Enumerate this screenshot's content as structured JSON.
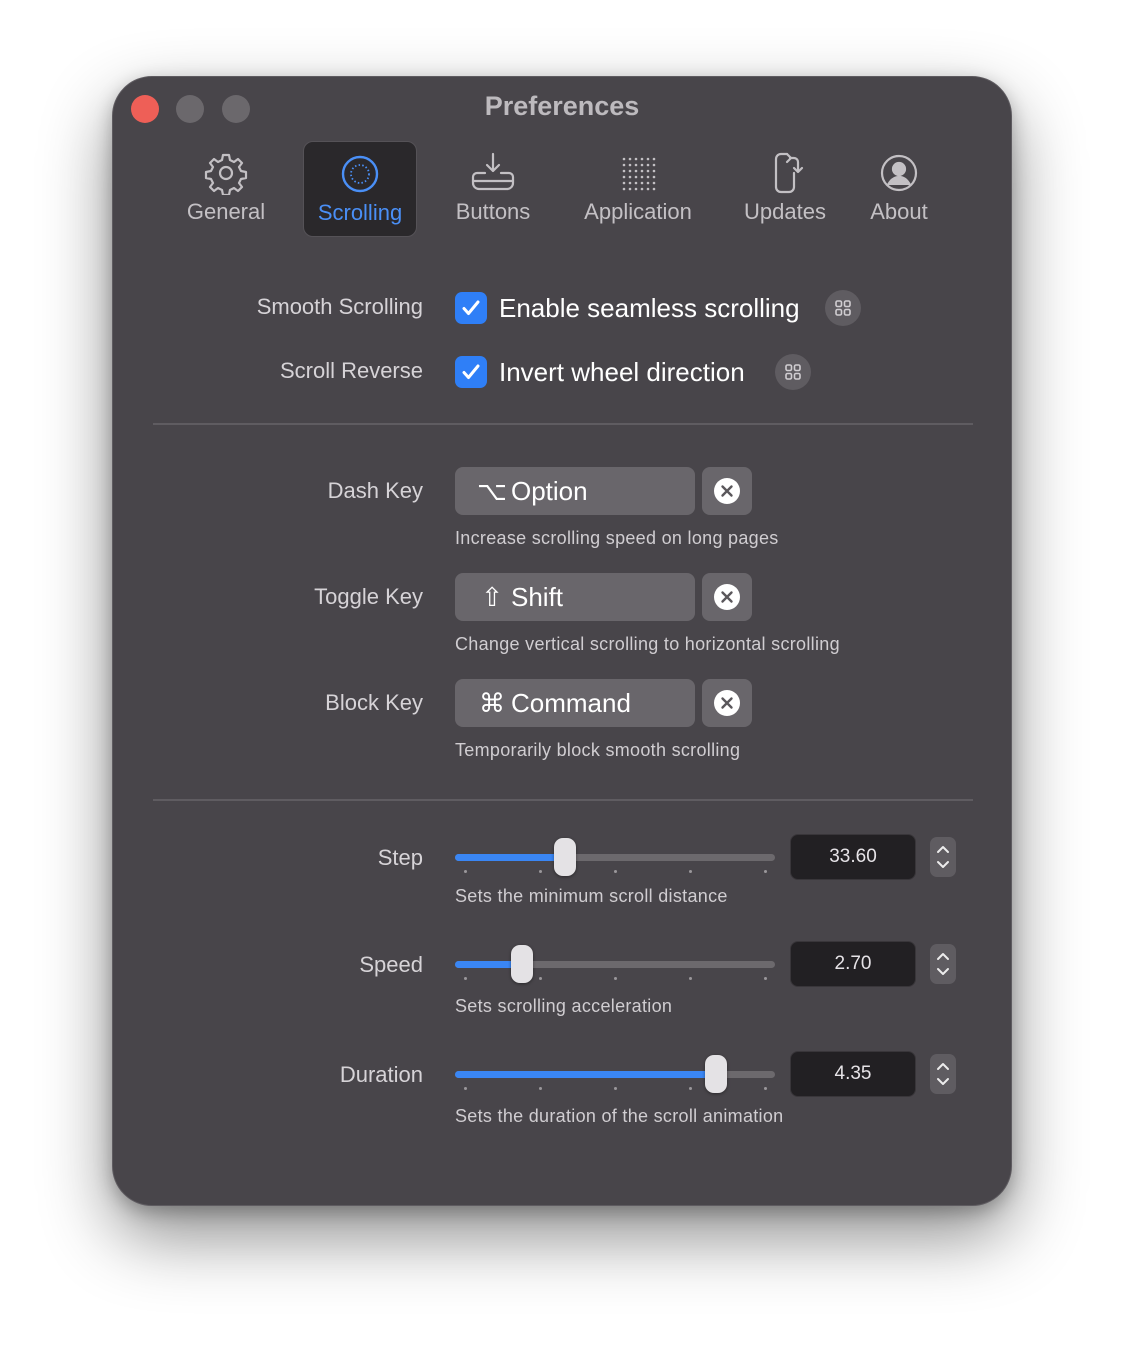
{
  "window": {
    "title": "Preferences"
  },
  "tabs": [
    {
      "label": "General",
      "icon": "gear-icon"
    },
    {
      "label": "Scrolling",
      "icon": "scroll-circle-icon",
      "active": true
    },
    {
      "label": "Buttons",
      "icon": "tray-download-icon"
    },
    {
      "label": "Application",
      "icon": "dot-grid-icon"
    },
    {
      "label": "Updates",
      "icon": "refresh-device-icon"
    },
    {
      "label": "About",
      "icon": "person-circle-icon"
    }
  ],
  "smooth_scrolling": {
    "label": "Smooth Scrolling",
    "checkbox_text": "Enable seamless scrolling",
    "checked": true
  },
  "scroll_reverse": {
    "label": "Scroll Reverse",
    "checkbox_text": "Invert wheel direction",
    "checked": true
  },
  "keys": {
    "dash": {
      "label": "Dash Key",
      "glyph": "⌥",
      "value": "Option",
      "hint": "Increase scrolling speed on long pages"
    },
    "toggle": {
      "label": "Toggle Key",
      "glyph": "⇧",
      "value": "Shift",
      "hint": "Change vertical scrolling to horizontal scrolling"
    },
    "block": {
      "label": "Block Key",
      "glyph": "⌘",
      "value": "Command",
      "hint": "Temporarily block smooth scrolling"
    }
  },
  "sliders": {
    "step": {
      "label": "Step",
      "value": "33.60",
      "fraction": 0.345,
      "hint": "Sets the minimum scroll distance"
    },
    "speed": {
      "label": "Speed",
      "value": "2.70",
      "fraction": 0.21,
      "hint": "Sets scrolling acceleration"
    },
    "duration": {
      "label": "Duration",
      "value": "4.35",
      "fraction": 0.815,
      "hint": "Sets the duration of the scroll animation"
    }
  },
  "colors": {
    "accent": "#2f7ff7",
    "close": "#ee5f57",
    "window_bg": "#48454a"
  }
}
